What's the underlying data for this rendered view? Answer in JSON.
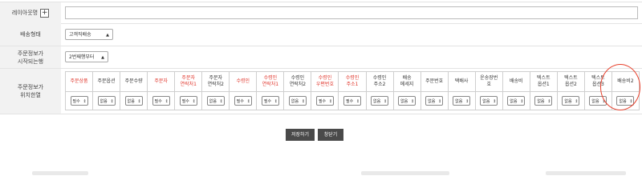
{
  "rows": {
    "layout": {
      "label": "레이아웃명",
      "plus": "+",
      "value": ""
    },
    "delivery": {
      "label": "배송형태",
      "value": "고객직배송"
    },
    "start": {
      "label_line1": "주문정보가",
      "label_line2": "시작되는행",
      "value": "2번째행부터"
    },
    "position": {
      "label_line1": "주문정보가",
      "label_line2": "위치한열"
    }
  },
  "columns": [
    {
      "line1": "주문상품",
      "line2": "",
      "red": true,
      "value": "필수"
    },
    {
      "line1": "주문옵션",
      "line2": "",
      "red": false,
      "value": "없음"
    },
    {
      "line1": "주문수량",
      "line2": "",
      "red": false,
      "value": "없음"
    },
    {
      "line1": "주문자",
      "line2": "",
      "red": true,
      "value": "필수"
    },
    {
      "line1": "주문자",
      "line2": "연락처1",
      "red": true,
      "value": "필수"
    },
    {
      "line1": "주문자",
      "line2": "연락처2",
      "red": false,
      "value": "없음"
    },
    {
      "line1": "수령인",
      "line2": "",
      "red": true,
      "value": "필수"
    },
    {
      "line1": "수령인",
      "line2": "연락처1",
      "red": true,
      "value": "필수"
    },
    {
      "line1": "수령인",
      "line2": "연락처2",
      "red": false,
      "value": "없음"
    },
    {
      "line1": "수령인",
      "line2": "우편번호",
      "red": true,
      "value": "필수"
    },
    {
      "line1": "수령인",
      "line2": "주소1",
      "red": true,
      "value": "필수"
    },
    {
      "line1": "수령인",
      "line2": "주소2",
      "red": false,
      "value": "없음"
    },
    {
      "line1": "배송",
      "line2": "메세지",
      "red": false,
      "value": "없음"
    },
    {
      "line1": "주문번호",
      "line2": "",
      "red": false,
      "value": "없음"
    },
    {
      "line1": "택배사",
      "line2": "",
      "red": false,
      "value": "없음"
    },
    {
      "line1": "운송장번",
      "line2": "호",
      "red": false,
      "value": "없음"
    },
    {
      "line1": "배송비",
      "line2": "",
      "red": false,
      "value": "없음"
    },
    {
      "line1": "텍스트",
      "line2": "옵션1",
      "red": false,
      "value": "없음"
    },
    {
      "line1": "텍스트",
      "line2": "옵션2",
      "red": false,
      "value": "없음"
    },
    {
      "line1": "텍스트",
      "line2": "옵션3",
      "red": false,
      "value": "없음"
    },
    {
      "line1": "배송비2",
      "line2": "",
      "red": false,
      "value": "없음"
    }
  ],
  "buttons": {
    "save": "저장하기",
    "close": "창닫기"
  },
  "colors": {
    "required": "#e0342a",
    "highlight": "#e8402c",
    "button": "#4a4a4a"
  }
}
